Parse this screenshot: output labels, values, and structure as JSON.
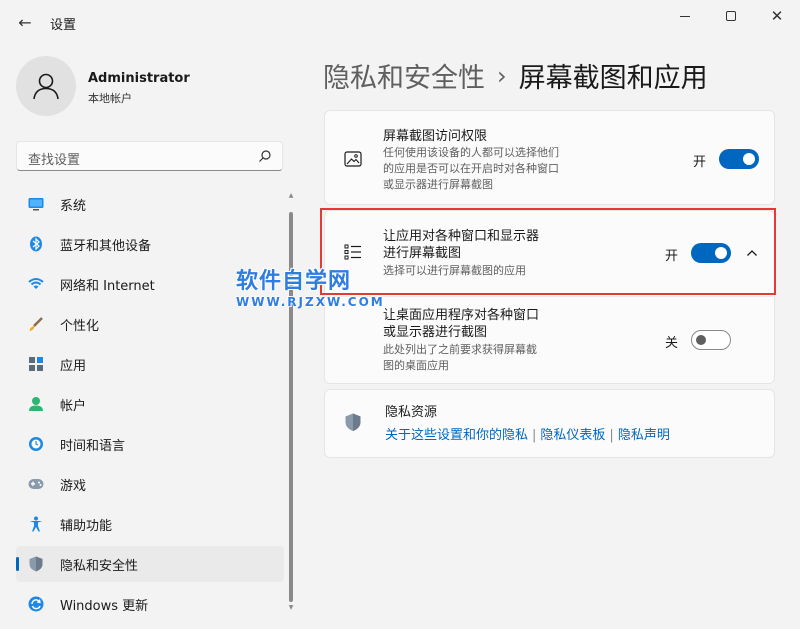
{
  "window": {
    "title": "设置",
    "back_icon": "back-arrow-icon",
    "controls": [
      "minimize",
      "maximize",
      "close"
    ]
  },
  "user": {
    "name": "Administrator",
    "account_type": "本地帐户"
  },
  "search": {
    "placeholder": "查找设置"
  },
  "sidebar": {
    "items": [
      {
        "label": "系统",
        "icon": "system-icon",
        "active": false
      },
      {
        "label": "蓝牙和其他设备",
        "icon": "bluetooth-icon",
        "active": false
      },
      {
        "label": "网络和 Internet",
        "icon": "wifi-icon",
        "active": false
      },
      {
        "label": "个性化",
        "icon": "brush-icon",
        "active": false
      },
      {
        "label": "应用",
        "icon": "apps-icon",
        "active": false
      },
      {
        "label": "帐户",
        "icon": "account-icon",
        "active": false
      },
      {
        "label": "时间和语言",
        "icon": "time-language-icon",
        "active": false
      },
      {
        "label": "游戏",
        "icon": "gamepad-icon",
        "active": false
      },
      {
        "label": "辅助功能",
        "icon": "accessibility-icon",
        "active": false
      },
      {
        "label": "隐私和安全性",
        "icon": "shield-icon",
        "active": true
      },
      {
        "label": "Windows 更新",
        "icon": "update-icon",
        "active": false
      }
    ]
  },
  "breadcrumb": {
    "parent": "隐私和安全性",
    "separator": "›",
    "current": "屏幕截图和应用"
  },
  "settings": {
    "screenshot_access": {
      "title": "屏幕截图访问权限",
      "desc_line1": "任何使用该设备的人都可以选择他们",
      "desc_line2": "的应用是否可以在开启时对各种窗口",
      "desc_line3": "或显示器进行屏幕截图",
      "state_label": "开",
      "enabled": true
    },
    "apps_screenshot": {
      "title_line1": "让应用对各种窗口和显示器",
      "title_line2": "进行屏幕截图",
      "desc": "选择可以进行屏幕截图的应用",
      "state_label": "开",
      "enabled": true,
      "expanded": true
    },
    "desktop_apps_screenshot": {
      "title_line1": "让桌面应用程序对各种窗口",
      "title_line2": "或显示器进行截图",
      "desc_line1": "此处列出了之前要求获得屏幕截",
      "desc_line2": "图的桌面应用",
      "state_label": "关",
      "enabled": false
    }
  },
  "privacy_resources": {
    "title": "隐私资源",
    "links": [
      "关于这些设置和你的隐私",
      "隐私仪表板",
      "隐私声明"
    ],
    "separator": "|"
  },
  "watermark": {
    "main": "软件自学网",
    "sub": "WWW.RJZXW.COM"
  },
  "colors": {
    "accent": "#0067c0",
    "highlight_border": "#e53935",
    "watermark": "#2f7de1"
  }
}
